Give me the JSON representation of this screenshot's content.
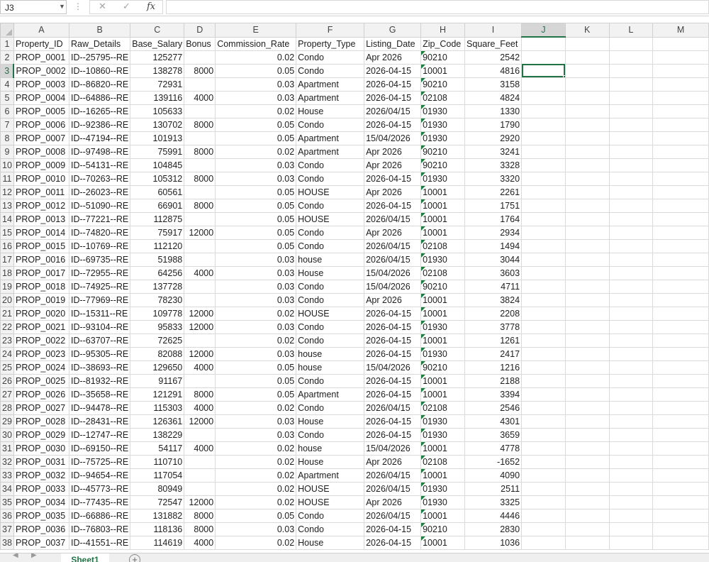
{
  "formula_bar": {
    "name_box": "J3",
    "cancel_icon": "✕",
    "enter_icon": "✓",
    "fx_label": "fx",
    "formula": ""
  },
  "columns": [
    "A",
    "B",
    "C",
    "D",
    "E",
    "F",
    "G",
    "H",
    "I",
    "J",
    "K",
    "L",
    "M"
  ],
  "selected_column": "J",
  "selected_row": 3,
  "active_cell": "J3",
  "rows": [
    [
      "Property_ID",
      "Raw_Details",
      "Base_Salary",
      "Bonus",
      "Commission_Rate",
      "Property_Type",
      "Listing_Date",
      "Zip_Code",
      "Square_Feet"
    ],
    [
      "PROP_0001",
      "ID--25795--RE",
      "125277",
      "",
      "0.02",
      " Condo",
      "Apr 2026",
      "90210",
      "2542"
    ],
    [
      "PROP_0002",
      "ID--10860--RE",
      "138278",
      "8000",
      "0.05",
      "Condo",
      "2026-04-15",
      "10001",
      "4816"
    ],
    [
      "PROP_0003",
      "ID--86820--RE",
      "72931",
      "",
      "0.03",
      "Apartment",
      "2026-04-15",
      "90210",
      "3158"
    ],
    [
      "PROP_0004",
      "ID--64886--RE",
      "139116",
      "4000",
      "0.03",
      "Apartment",
      "2026-04-15",
      "02108",
      "4824"
    ],
    [
      "PROP_0005",
      "ID--16265--RE",
      "105633",
      "",
      "0.02",
      "House",
      "2026/04/15",
      "01930",
      "1330"
    ],
    [
      "PROP_0006",
      "ID--92386--RE",
      "130702",
      "8000",
      "0.05",
      "Condo",
      "2026-04-15",
      "01930",
      "1790"
    ],
    [
      "PROP_0007",
      "ID--47194--RE",
      "101913",
      "",
      "0.05",
      "Apartment",
      "15/04/2026",
      "01930",
      "2920"
    ],
    [
      "PROP_0008",
      "ID--97498--RE",
      "75991",
      "8000",
      "0.02",
      "Apartment",
      "Apr 2026",
      "90210",
      "3241"
    ],
    [
      "PROP_0009",
      "ID--54131--RE",
      "104845",
      "",
      "0.03",
      "Condo",
      "Apr 2026",
      "90210",
      "3328"
    ],
    [
      "PROP_0010",
      "ID--70263--RE",
      "105312",
      "8000",
      "0.03",
      " Condo",
      "2026-04-15",
      "01930",
      "3320"
    ],
    [
      "PROP_0011",
      "ID--26023--RE",
      "60561",
      "",
      "0.05",
      "HOUSE",
      "Apr 2026",
      "10001",
      "2261"
    ],
    [
      "PROP_0012",
      "ID--51090--RE",
      "66901",
      "8000",
      "0.05",
      "Condo",
      "2026-04-15",
      "10001",
      "1751"
    ],
    [
      "PROP_0013",
      "ID--77221--RE",
      "112875",
      "",
      "0.05",
      "HOUSE",
      "2026/04/15",
      "10001",
      "1764"
    ],
    [
      "PROP_0014",
      "ID--74820--RE",
      "75917",
      "12000",
      "0.05",
      " Condo",
      "Apr 2026",
      "10001",
      "2934"
    ],
    [
      "PROP_0015",
      "ID--10769--RE",
      "112120",
      "",
      "0.05",
      " Condo",
      "2026/04/15",
      "02108",
      "1494"
    ],
    [
      "PROP_0016",
      "ID--69735--RE",
      "51988",
      "",
      "0.03",
      "house",
      "2026/04/15",
      "01930",
      "3044"
    ],
    [
      "PROP_0017",
      "ID--72955--RE",
      "64256",
      "4000",
      "0.03",
      "House",
      "15/04/2026",
      "02108",
      "3603"
    ],
    [
      "PROP_0018",
      "ID--74925--RE",
      "137728",
      "",
      "0.03",
      " Condo",
      "15/04/2026",
      "90210",
      "4711"
    ],
    [
      "PROP_0019",
      "ID--77969--RE",
      "78230",
      "",
      "0.03",
      " Condo",
      "Apr 2026",
      "10001",
      "3824"
    ],
    [
      "PROP_0020",
      "ID--15311--RE",
      "109778",
      "12000",
      "0.02",
      "HOUSE",
      "2026-04-15",
      "10001",
      "2208"
    ],
    [
      "PROP_0021",
      "ID--93104--RE",
      "95833",
      "12000",
      "0.03",
      " Condo",
      "2026-04-15",
      "01930",
      "3778"
    ],
    [
      "PROP_0022",
      "ID--63707--RE",
      "72625",
      "",
      "0.02",
      "Condo",
      "2026-04-15",
      "10001",
      "1261"
    ],
    [
      "PROP_0023",
      "ID--95305--RE",
      "82088",
      "12000",
      "0.03",
      "house",
      "2026-04-15",
      "01930",
      "2417"
    ],
    [
      "PROP_0024",
      "ID--38693--RE",
      "129650",
      "4000",
      "0.05",
      "house",
      "15/04/2026",
      "90210",
      "1216"
    ],
    [
      "PROP_0025",
      "ID--81932--RE",
      "91167",
      "",
      "0.05",
      "Condo",
      "2026-04-15",
      "10001",
      "2188"
    ],
    [
      "PROP_0026",
      "ID--35658--RE",
      "121291",
      "8000",
      "0.05",
      "Apartment",
      "2026-04-15",
      "10001",
      "3394"
    ],
    [
      "PROP_0027",
      "ID--94478--RE",
      "115303",
      "4000",
      "0.02",
      " Condo",
      "2026/04/15",
      "02108",
      "2546"
    ],
    [
      "PROP_0028",
      "ID--28431--RE",
      "126361",
      "12000",
      "0.03",
      "House",
      "2026-04-15",
      "01930",
      "4301"
    ],
    [
      "PROP_0029",
      "ID--12747--RE",
      "138229",
      "",
      "0.03",
      " Condo",
      "2026-04-15",
      "01930",
      "3659"
    ],
    [
      "PROP_0030",
      "ID--69150--RE",
      "54117",
      "4000",
      "0.02",
      "house",
      "15/04/2026",
      "10001",
      "4778"
    ],
    [
      "PROP_0031",
      "ID--75725--RE",
      "110710",
      "",
      "0.02",
      "House",
      "Apr 2026",
      "02108",
      "-1652"
    ],
    [
      "PROP_0032",
      "ID--94654--RE",
      "117054",
      "",
      "0.02",
      "Apartment",
      "2026/04/15",
      "10001",
      "4090"
    ],
    [
      "PROP_0033",
      "ID--45773--RE",
      "80949",
      "",
      "0.02",
      "HOUSE",
      "2026/04/15",
      "01930",
      "2511"
    ],
    [
      "PROP_0034",
      "ID--77435--RE",
      "72547",
      "12000",
      "0.02",
      "HOUSE",
      "Apr 2026",
      "01930",
      "3325"
    ],
    [
      "PROP_0035",
      "ID--66886--RE",
      "131882",
      "8000",
      "0.05",
      " Condo",
      "2026/04/15",
      "10001",
      "4446"
    ],
    [
      "PROP_0036",
      "ID--76803--RE",
      "118136",
      "8000",
      "0.03",
      " Condo",
      "2026-04-15",
      "90210",
      "2830"
    ],
    [
      "PROP_0037",
      "ID--41551--RE",
      "114619",
      "4000",
      "0.02",
      "House",
      "2026-04-15",
      "10001",
      "1036"
    ]
  ],
  "sheet_tabs": {
    "prev_icon": "◀",
    "next_icon": "▶",
    "active_sheet": "Sheet1",
    "add_icon": "+"
  },
  "colors": {
    "accent": "#217346",
    "header_bg": "#f2f2f2",
    "gridline": "#dadada"
  }
}
